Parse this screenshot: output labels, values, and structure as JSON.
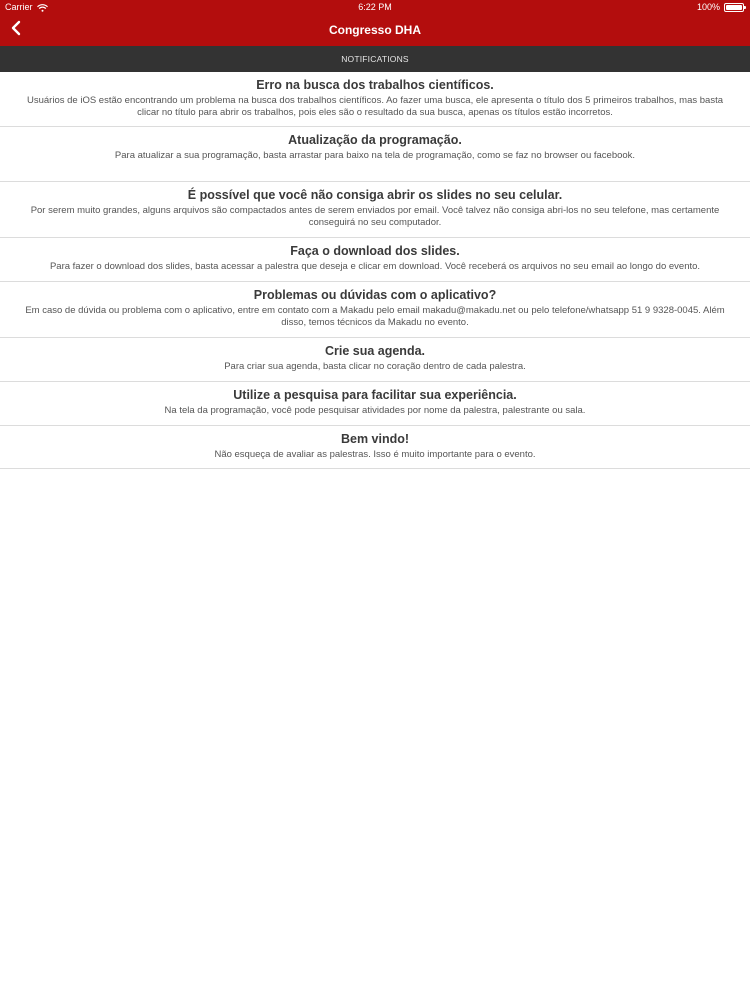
{
  "status_bar": {
    "carrier": "Carrier",
    "time": "6:22 PM",
    "battery": "100%"
  },
  "nav": {
    "title": "Congresso DHA",
    "back_icon": "chevron-left-icon"
  },
  "section": {
    "label": "NOTIFICATIONS"
  },
  "colors": {
    "header": "#b30d0d",
    "section_bar": "#333333"
  },
  "notifications": [
    {
      "title": "Erro na busca dos trabalhos científicos.",
      "body": "Usuários de iOS estão encontrando um problema na busca dos trabalhos científicos. Ao fazer uma busca, ele apresenta o título dos 5 primeiros trabalhos, mas basta clicar no título para abrir os trabalhos, pois eles são o resultado da sua busca, apenas os títulos estão incorretos."
    },
    {
      "title": "Atualização da programação.",
      "body": "Para atualizar a sua programação, basta arrastar para baixo na tela de programação, como se faz no browser ou facebook."
    },
    {
      "title": "É possível que você não consiga abrir os slides no seu celular.",
      "body": "Por serem muito grandes, alguns arquivos são compactados antes de serem enviados por email. Você talvez não consiga abri-los no seu telefone, mas certamente conseguirá no seu computador."
    },
    {
      "title": "Faça o download dos slides.",
      "body": "Para fazer o download dos slides, basta acessar a palestra que deseja e clicar em download. Você receberá os arquivos no seu email ao longo do evento."
    },
    {
      "title": "Problemas ou dúvidas com o aplicativo?",
      "body": "Em caso de dúvida ou problema com o aplicativo, entre em contato com a Makadu pelo email makadu@makadu.net ou pelo telefone/whatsapp 51 9 9328-0045. Além disso, temos técnicos da Makadu no evento."
    },
    {
      "title": "Crie sua agenda.",
      "body": "Para criar sua agenda, basta clicar no coração dentro de cada palestra."
    },
    {
      "title": "Utilize a pesquisa para facilitar sua experiência.",
      "body": "Na tela da programação, você pode pesquisar atividades por nome da palestra, palestrante ou sala."
    },
    {
      "title": "Bem vindo!",
      "body": "Não esqueça de avaliar as palestras. Isso é muito importante para o evento."
    }
  ]
}
